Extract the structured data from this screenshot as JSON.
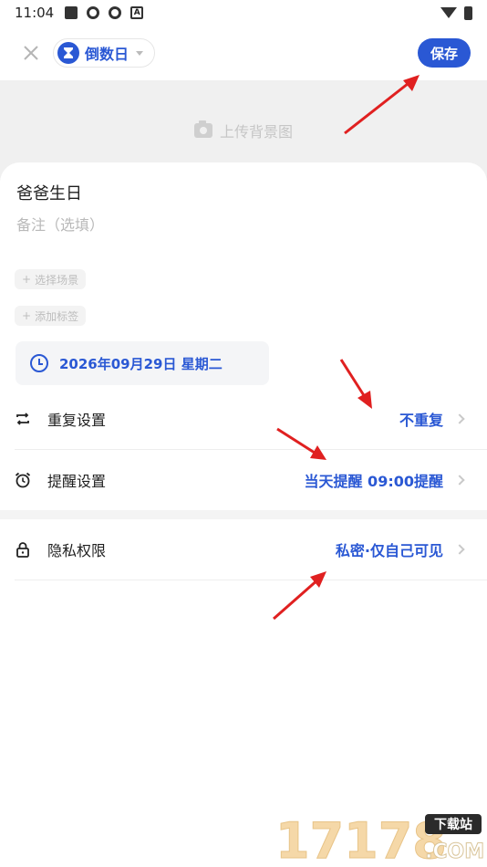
{
  "status_bar": {
    "time": "11:04"
  },
  "header": {
    "type_label": "倒数日",
    "save_label": "保存"
  },
  "upload": {
    "label": "上传背景图"
  },
  "event": {
    "title": "爸爸生日",
    "note_placeholder": "备注（选填）"
  },
  "chips": {
    "scene": "选择场景",
    "tag": "添加标签"
  },
  "date": {
    "text": "2026年09月29日 星期二"
  },
  "settings": {
    "repeat": {
      "label": "重复设置",
      "value": "不重复"
    },
    "reminder": {
      "label": "提醒设置",
      "value": "当天提醒 09:00提醒"
    },
    "privacy": {
      "label": "隐私权限",
      "value": "私密·仅自己可见"
    }
  },
  "watermark": {
    "text_main": "17178",
    "text_badge": "下载站",
    "text_sub": ".COM"
  },
  "colors": {
    "accent": "#2a58d4",
    "annotation": "#e02020"
  }
}
